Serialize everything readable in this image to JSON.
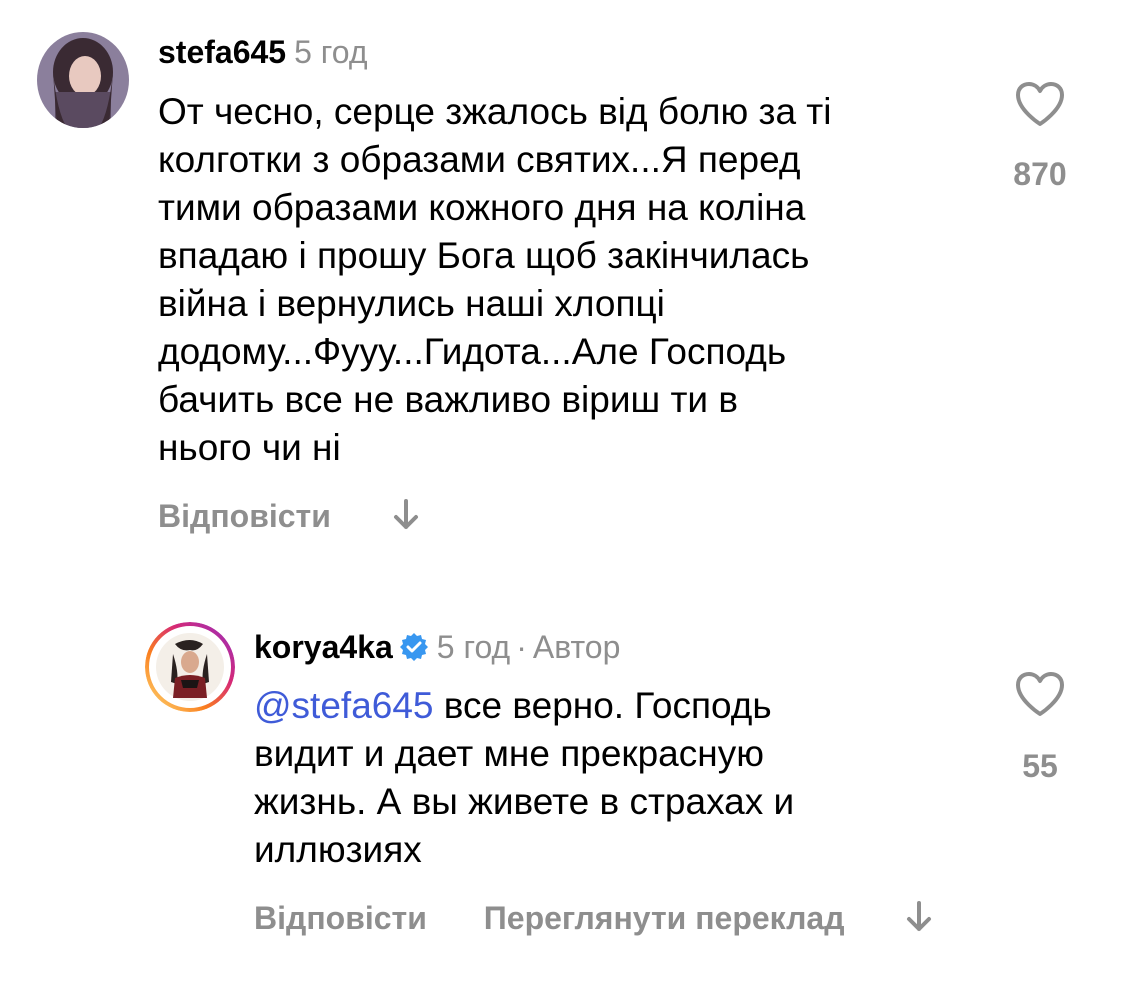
{
  "comments": [
    {
      "username": "stefa645",
      "time": "5 год",
      "text": "От чесно, серце зжалось від болю за ті колготки з образами святих...Я перед тими образами кожного дня на коліна впадаю і прошу Бога щоб закінчилась війна і вернулись наші хлопці додому...Фууу...Гидота...Але Господь бачить все не важливо віриш ти в нього чи ні",
      "lines": [
        "От чесно, серце зжалось від болю за ті",
        "колготки з образами святих...Я перед",
        "тими образами кожного дня на коліна",
        "впадаю і прошу Бога щоб закінчилась",
        "війна і вернулись наші хлопці",
        "додому...Фууу...Гидота...Але Господь",
        "бачить все не важливо віриш ти в",
        "нього чи ні"
      ],
      "likes": "870",
      "reply_label": "Відповісти",
      "like_icon": "heart-outline-icon",
      "avatar_icon": "user-avatar"
    },
    {
      "username": "korya4ka",
      "verified": true,
      "time": "5 год",
      "separator": "·",
      "role": "Автор",
      "mention": "@stefa645",
      "lines": [
        " все верно. Господь",
        "видит и дает мне прекрасную",
        "жизнь. А вы живете в страхах и",
        "иллюзиях"
      ],
      "likes": "55",
      "reply_label": "Відповісти",
      "translate_label": "Переглянути переклад",
      "like_icon": "heart-outline-icon",
      "avatar_icon": "story-ring-avatar"
    }
  ],
  "colors": {
    "text": "#000000",
    "secondary": "#8e8e8e",
    "mention": "#3f5bd8",
    "verified": "#3897f0"
  }
}
